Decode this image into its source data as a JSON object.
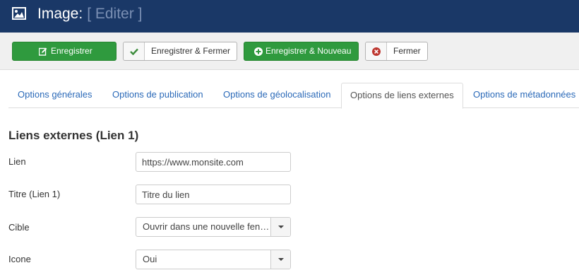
{
  "header": {
    "icon": "image-icon",
    "title": "Image:",
    "subtitle": "[ Editer ]"
  },
  "toolbar": {
    "save_label": "Enregistrer",
    "save_close_label": "Enregistrer & Fermer",
    "save_new_label": "Enregistrer & Nouveau",
    "close_label": "Fermer"
  },
  "tabs": [
    {
      "label": "Options générales"
    },
    {
      "label": "Options de publication"
    },
    {
      "label": "Options de géolocalisation"
    },
    {
      "label": "Options de liens externes",
      "active": true
    },
    {
      "label": "Options de métadonnées"
    }
  ],
  "section": {
    "title": "Liens externes (Lien 1)"
  },
  "form": {
    "link": {
      "label": "Lien",
      "value": "https://www.monsite.com"
    },
    "link_title": {
      "label": "Titre (Lien 1)",
      "value": "Titre du lien"
    },
    "target": {
      "label": "Cible",
      "value": "Ouvrir dans une nouvelle fen…"
    },
    "icon": {
      "label": "Icone",
      "value": "Oui"
    }
  },
  "colors": {
    "header_bg": "#1a3867",
    "primary_green": "#2f9a3e",
    "tab_link": "#2a69b8",
    "close_red": "#bd362f",
    "check_green": "#3c8c3c"
  }
}
